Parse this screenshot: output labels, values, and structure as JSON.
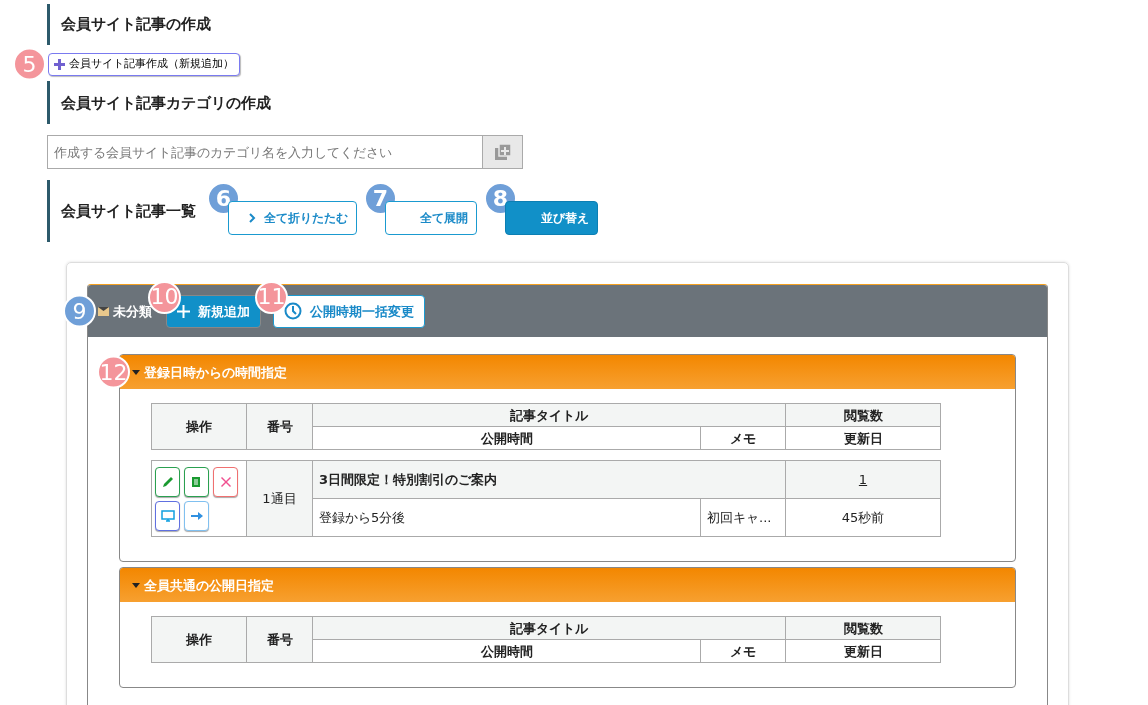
{
  "create_section": {
    "title": "会員サイト記事の作成",
    "button": {
      "label": "会員サイト記事作成（新規追加）",
      "callout": {
        "label": "5",
        "color": "#f4959b"
      }
    }
  },
  "category_section": {
    "title": "会員サイト記事カテゴリの作成",
    "input": {
      "placeholder": "作成する会員サイト記事のカテゴリ名を入力してください"
    }
  },
  "list_section": {
    "title": "会員サイト記事一覧",
    "buttons": [
      {
        "label": "全て折りたたむ",
        "kind": "collapse",
        "callout": {
          "label": "6",
          "color": "#6f9fd8"
        }
      },
      {
        "label": "全て展開",
        "kind": "expand",
        "callout": {
          "label": "7",
          "color": "#6f9fd8"
        }
      },
      {
        "label": "並び替え",
        "kind": "sort",
        "callout": {
          "label": "8",
          "color": "#6f9fd8"
        }
      }
    ]
  },
  "categories": [
    {
      "name": "未分類",
      "callout": {
        "label": "9",
        "color": "#6f9fd8"
      },
      "buttons": [
        {
          "label": "新規追加",
          "kind": "add",
          "callout": {
            "label": "10",
            "color": "#f4959b"
          }
        },
        {
          "label": "公開時期一括変更",
          "kind": "schedule",
          "callout": {
            "label": "11",
            "color": "#f4959b"
          }
        }
      ],
      "groups": [
        {
          "title": "登録日時からの時間指定",
          "callout": {
            "label": "12",
            "color": "#f4959b"
          },
          "headers": [
            "操作",
            "番号",
            "記事タイトル",
            "閲覧数",
            "公開時間",
            "メモ",
            "更新日"
          ],
          "rows": [
            {
              "number": "1通目",
              "title": "3日間限定！特別割引のご案内",
              "views": "1",
              "timing": "登録から5分後",
              "memo": "初回キャ...",
              "updated": "45秒前"
            }
          ]
        },
        {
          "title": "全員共通の公開日指定",
          "headers": [
            "操作",
            "番号",
            "記事タイトル",
            "閲覧数",
            "公開時間",
            "メモ",
            "更新日"
          ]
        }
      ]
    }
  ]
}
